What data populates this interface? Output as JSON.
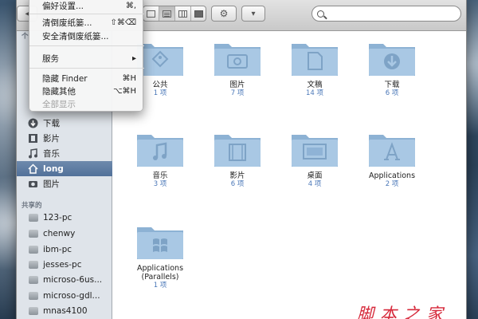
{
  "window": {
    "title_fragment": "long"
  },
  "toolbar": {
    "nav_back": "◂",
    "action_label": "⚙",
    "arrange_label": "▾",
    "search_placeholder": "",
    "search_value": ""
  },
  "app_menu": {
    "items": [
      {
        "label": "偏好设置...",
        "shortcut": "⌘,",
        "disabled": false
      },
      {
        "label": "清倒废纸篓...",
        "shortcut": "⇧⌘⌫",
        "disabled": false
      },
      {
        "label": "安全清倒废纸篓...",
        "shortcut": "",
        "disabled": false
      },
      {
        "label": "服务",
        "shortcut": "▸",
        "disabled": false
      },
      {
        "label": "隐藏 Finder",
        "shortcut": "⌘H",
        "disabled": false
      },
      {
        "label": "隐藏其他",
        "shortcut": "⌥⌘H",
        "disabled": false
      },
      {
        "label": "全部显示",
        "shortcut": "",
        "disabled": true
      }
    ]
  },
  "sidebar": {
    "section_places": "个",
    "section_shared": "共享的",
    "places": [
      {
        "label": "下载",
        "icon": "download-icon"
      },
      {
        "label": "影片",
        "icon": "movies-icon"
      },
      {
        "label": "音乐",
        "icon": "music-icon"
      },
      {
        "label": "long",
        "icon": "home-icon",
        "selected": true
      },
      {
        "label": "图片",
        "icon": "camera-icon"
      }
    ],
    "shared": [
      {
        "label": "123-pc"
      },
      {
        "label": "chenwy"
      },
      {
        "label": "ibm-pc"
      },
      {
        "label": "jesses-pc"
      },
      {
        "label": "microso-6us..."
      },
      {
        "label": "microso-gdl..."
      },
      {
        "label": "mnas4100"
      }
    ]
  },
  "items": [
    {
      "label": "公共",
      "count": "1 项",
      "icon": "public-folder-icon"
    },
    {
      "label": "图片",
      "count": "7 项",
      "icon": "pictures-folder-icon"
    },
    {
      "label": "文稿",
      "count": "14 项",
      "icon": "documents-folder-icon"
    },
    {
      "label": "下载",
      "count": "6 项",
      "icon": "downloads-folder-icon"
    },
    {
      "label": "音乐",
      "count": "3 项",
      "icon": "music-folder-icon"
    },
    {
      "label": "影片",
      "count": "6 项",
      "icon": "movies-folder-icon"
    },
    {
      "label": "桌面",
      "count": "4 项",
      "icon": "desktop-folder-icon"
    },
    {
      "label": "Applications",
      "count": "2 项",
      "icon": "applications-folder-icon"
    },
    {
      "label": "Applications\n(Parallels)",
      "count": "1 项",
      "icon": "windows-folder-icon"
    }
  ],
  "watermark": {
    "text": "脚本之家"
  },
  "colors": {
    "selection": "#5f7ea5",
    "folder": "#9fc0de",
    "count": "#4b78b8",
    "watermark": "#d6283a"
  }
}
